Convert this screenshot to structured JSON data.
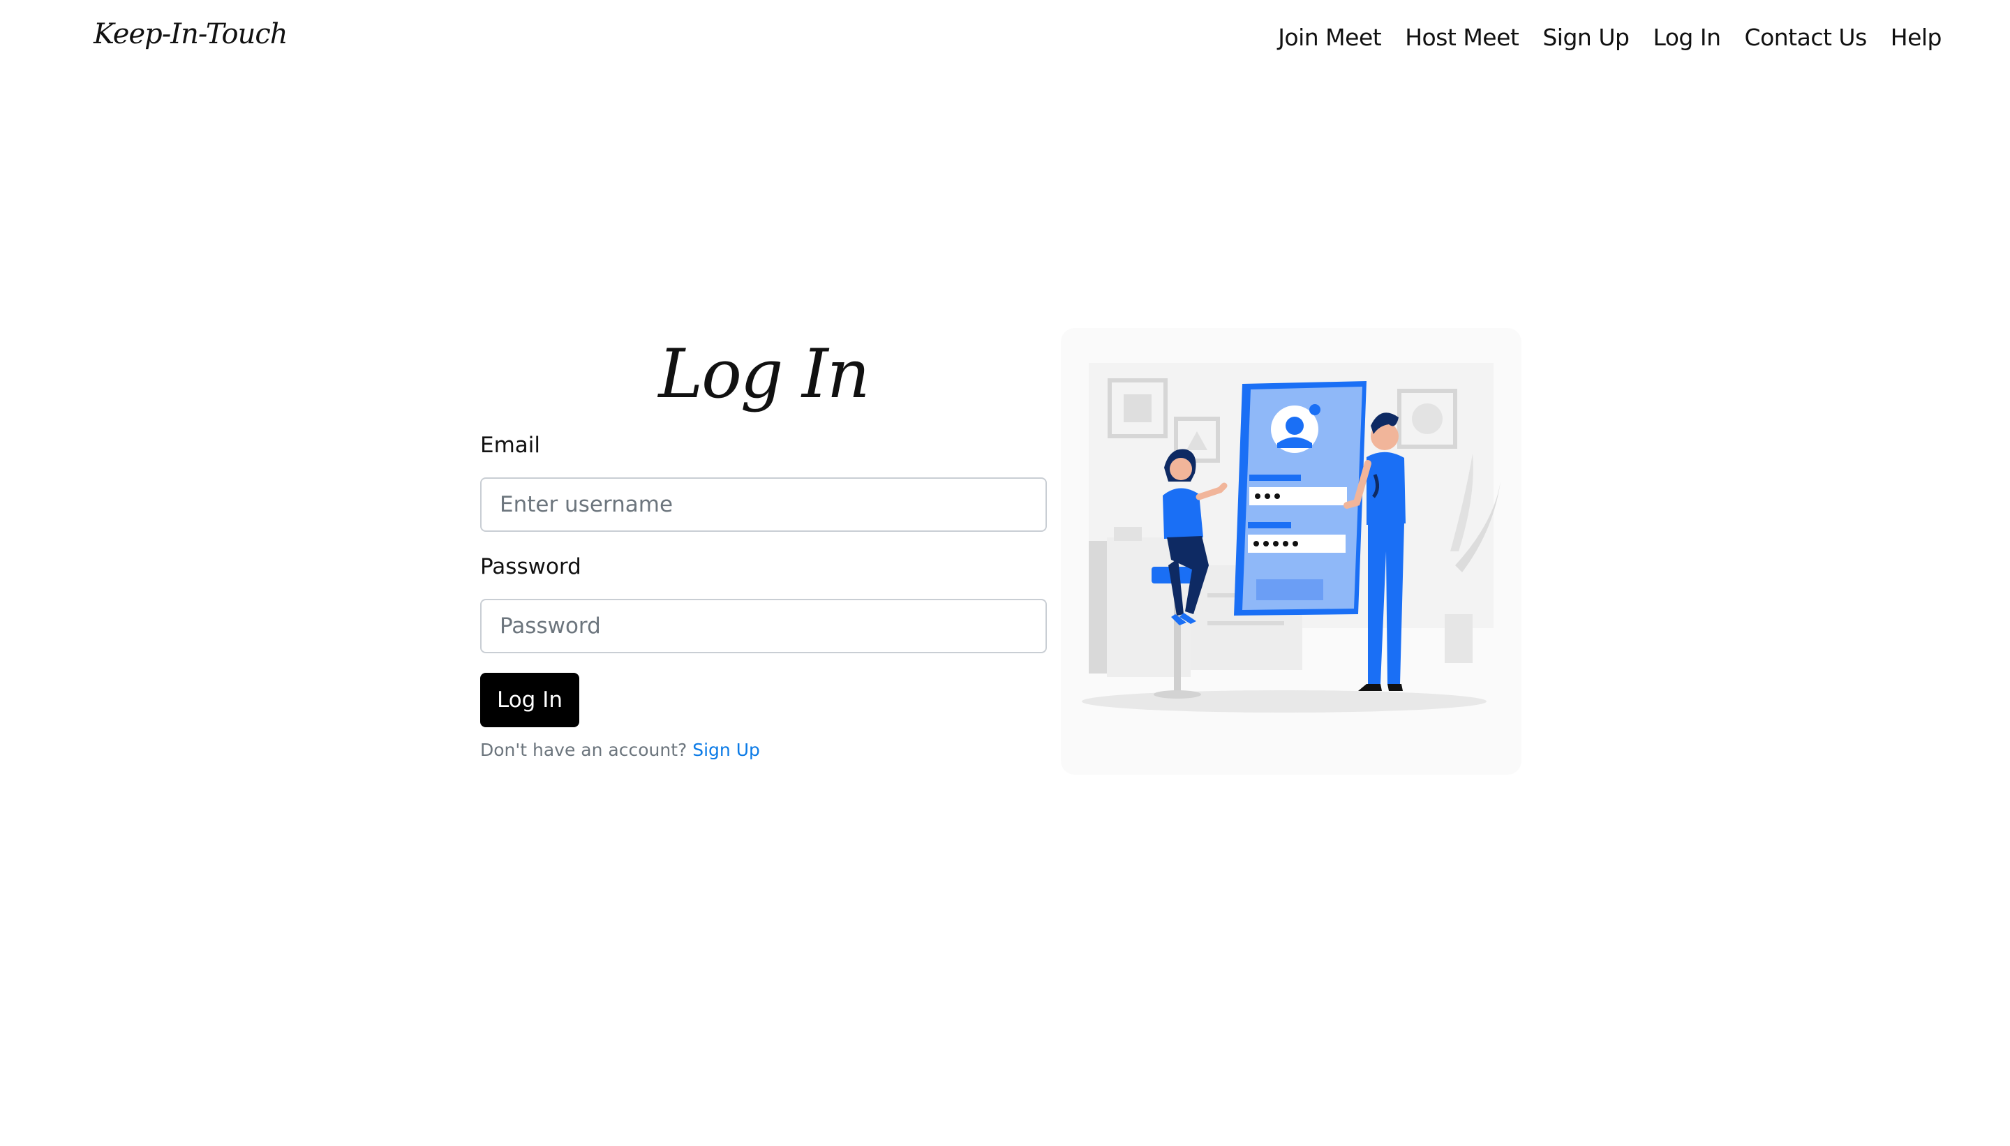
{
  "header": {
    "brand": "Keep-In-Touch",
    "nav": [
      {
        "label": "Join Meet"
      },
      {
        "label": "Host Meet"
      },
      {
        "label": "Sign Up"
      },
      {
        "label": "Log In"
      },
      {
        "label": "Contact Us"
      },
      {
        "label": "Help"
      }
    ]
  },
  "login": {
    "title": "Log In",
    "email_label": "Email",
    "email_placeholder": "Enter username",
    "password_label": "Password",
    "password_placeholder": "Password",
    "submit_label": "Log In",
    "signup_prompt": "Don't have an account?",
    "signup_link": "Sign Up"
  },
  "illustration": {
    "icon": "login-illustration",
    "colors": {
      "primary": "#1a6ff5",
      "light": "#8fb8f8",
      "dark": "#0e2a63"
    }
  },
  "theme": {
    "link": "#0a7ae6",
    "button": "#000000"
  }
}
